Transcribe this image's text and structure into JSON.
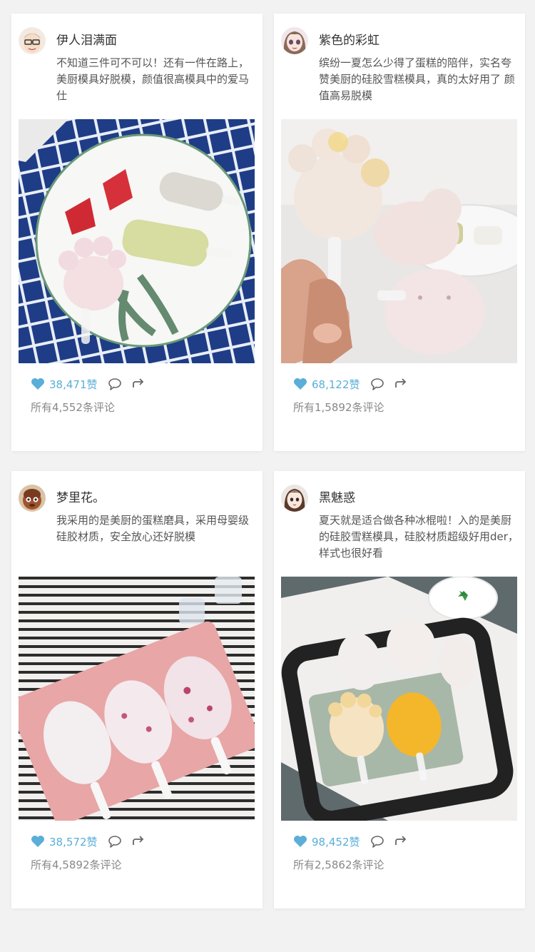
{
  "posts": [
    {
      "username": "伊人泪满面",
      "text": "不知道三件可不可以！还有一件在路上，美厨模具好脱模，颜值很高模具中的爱马仕",
      "likes": "38,471赞",
      "comments": "所有4,552条评论",
      "photo": "plate-with-popsicles-on-blue-checkered-cloth"
    },
    {
      "username": "紫色的彩虹",
      "text": "缤纷一夏怎么少得了蛋糕的陪伴，实名夸赞美厨的硅胶雪糕模具，真的太好用了 颜值高易脱模",
      "likes": "68,122赞",
      "comments": "所有1,5892条评论",
      "photo": "hand-holding-paw-popsicles"
    },
    {
      "username": "梦里花。",
      "text": "我采用的是美厨的蛋糕磨具，采用母婴级硅胶材质，安全放心还好脱模",
      "likes": "38,572赞",
      "comments": "所有4,5892条评论",
      "photo": "pink-mold-on-striped-cloth"
    },
    {
      "username": "黑魅惑",
      "text": "夏天就是适合做各种冰棍啦！入的是美厨的硅胶雪糕模具，硅胶材质超级好用der，样式也很好看",
      "likes": "98,452赞",
      "comments": "所有2,5862条评论",
      "photo": "green-mold-on-black-board"
    }
  ],
  "icons": {
    "like": "heart-icon",
    "comment": "comment-icon",
    "share": "share-icon"
  },
  "colors": {
    "accent": "#5aaed8",
    "muted": "#888888",
    "background": "#f2f2f2"
  }
}
